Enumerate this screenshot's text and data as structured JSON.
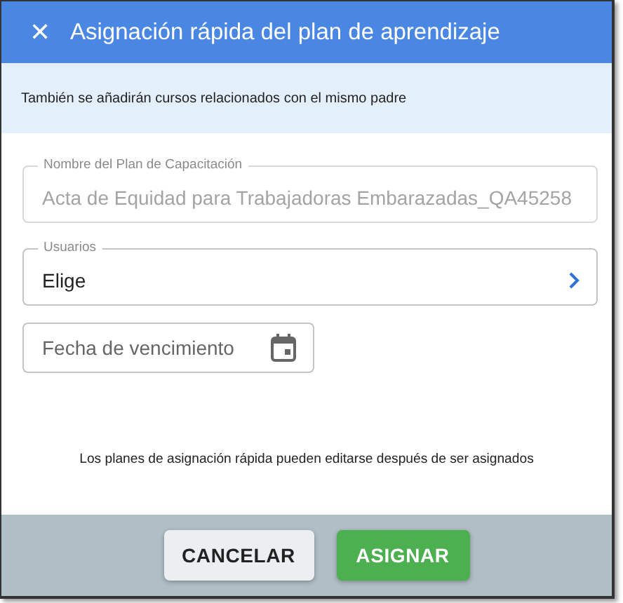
{
  "dialog": {
    "close_icon": "✕",
    "title": "Asignación rápida del plan de aprendizaje"
  },
  "info_banner": "También se añadirán cursos relacionados con el mismo padre",
  "fields": [
    {
      "kind": "text",
      "label": "Nombre del Plan de Capacitación",
      "value": "Acta de Equidad para Trabajadoras Embarazadas_QA45258",
      "disabled": true
    },
    {
      "kind": "select",
      "label": "Usuarios",
      "value": "Elige",
      "disabled": false
    },
    {
      "kind": "date",
      "placeholder": "Fecha de vencimiento",
      "disabled": false
    }
  ],
  "note": "Los planes de asignación rápida pueden editarse después de ser asignados",
  "buttons": [
    {
      "label": "CANCELAR",
      "kind": "secondary"
    },
    {
      "label": "ASIGNAR",
      "kind": "primary"
    }
  ]
}
